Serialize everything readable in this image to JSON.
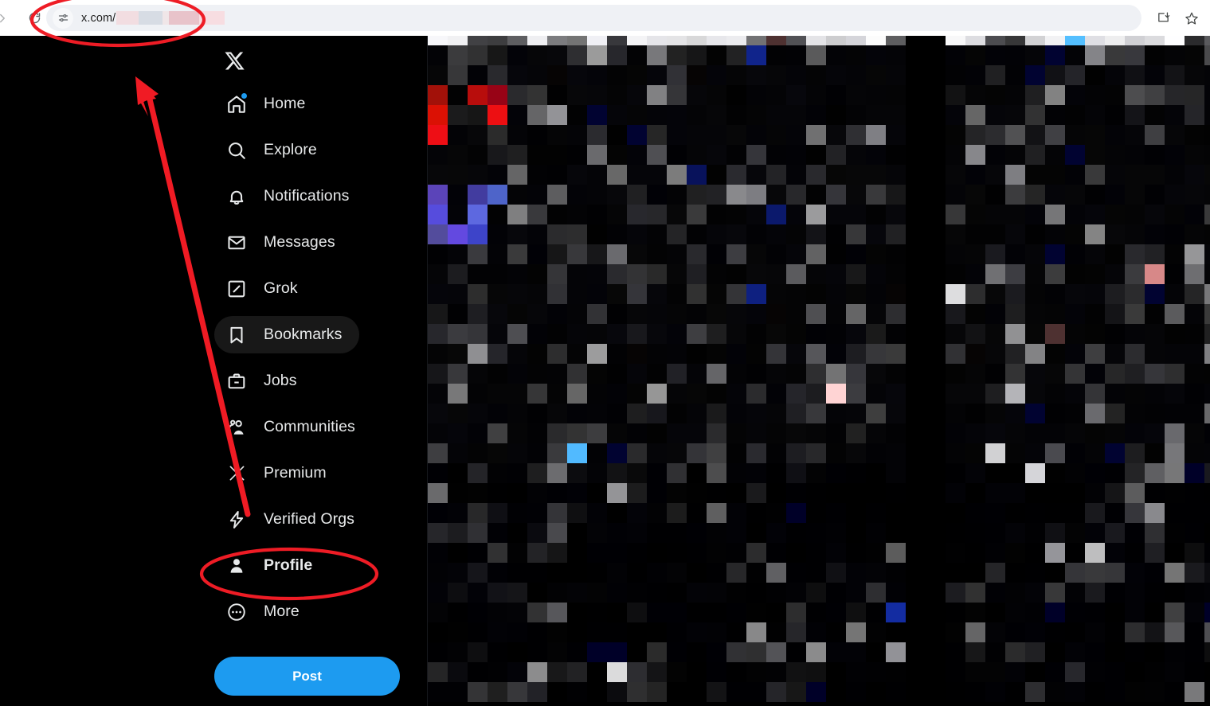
{
  "browser": {
    "back_icon": "back-arrow-icon",
    "forward_icon": "forward-arrow-icon",
    "reload_icon": "reload-icon",
    "site_settings_icon": "tune-sliders-icon",
    "url_prefix": "x.com/",
    "url_redacted": true,
    "install_icon": "install-app-icon",
    "bookmark_icon": "bookmark-star-icon"
  },
  "sidebar": {
    "logo": "x-logo-icon",
    "items": [
      {
        "label": "Home",
        "icon": "home-icon",
        "badge": true,
        "active": false,
        "bold": false
      },
      {
        "label": "Explore",
        "icon": "search-icon",
        "badge": false,
        "active": false,
        "bold": false
      },
      {
        "label": "Notifications",
        "icon": "bell-icon",
        "badge": false,
        "active": false,
        "bold": false
      },
      {
        "label": "Messages",
        "icon": "envelope-icon",
        "badge": false,
        "active": false,
        "bold": false
      },
      {
        "label": "Grok",
        "icon": "grok-icon",
        "badge": false,
        "active": false,
        "bold": false
      },
      {
        "label": "Bookmarks",
        "icon": "bookmark-icon",
        "badge": false,
        "active": true,
        "bold": false
      },
      {
        "label": "Jobs",
        "icon": "briefcase-icon",
        "badge": false,
        "active": false,
        "bold": false
      },
      {
        "label": "Communities",
        "icon": "communities-icon",
        "badge": false,
        "active": false,
        "bold": false
      },
      {
        "label": "Premium",
        "icon": "x-premium-icon",
        "badge": false,
        "active": false,
        "bold": false
      },
      {
        "label": "Verified Orgs",
        "icon": "lightning-bolt-icon",
        "badge": false,
        "active": false,
        "bold": false
      },
      {
        "label": "Profile",
        "icon": "person-icon",
        "badge": false,
        "active": false,
        "bold": true
      },
      {
        "label": "More",
        "icon": "more-circle-icon",
        "badge": false,
        "active": false,
        "bold": false
      }
    ],
    "post_button": "Post"
  },
  "content": {
    "state": "pixelated-redacted",
    "faint_footer_text": ""
  },
  "annotations": {
    "url_ellipse": {
      "shape": "ellipse",
      "color": "#ee1c25",
      "target": "omnibox-url"
    },
    "profile_ellipse": {
      "shape": "ellipse",
      "color": "#ee1c25",
      "target": "sidebar-item-profile"
    },
    "arrow": {
      "shape": "arrow",
      "color": "#f01b24",
      "from": "sidebar-item-profile",
      "to": "omnibox-url"
    }
  },
  "colors": {
    "accent_blue": "#1d9bf0",
    "annotation_red": "#ee1c25",
    "background": "#000000",
    "chrome_bg": "#ffffff",
    "omnibox_bg": "#eff1f5",
    "text_primary": "#e7e9ea",
    "active_pill": "#181818"
  }
}
